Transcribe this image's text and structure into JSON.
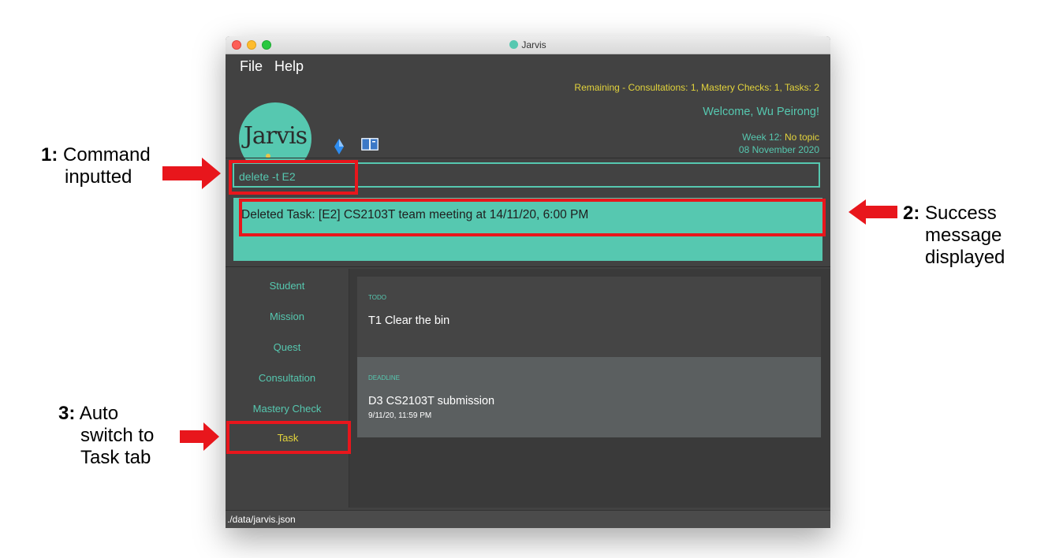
{
  "window": {
    "title": "Jarvis"
  },
  "menu": {
    "file": "File",
    "help": "Help"
  },
  "logo": {
    "text": "Jarvis"
  },
  "header": {
    "remaining": "Remaining - Consultations: 1, Mastery Checks: 1, Tasks: 2",
    "welcome": "Welcome, Wu Peirong!",
    "week_prefix": "Week 12: ",
    "week_topic": "No topic",
    "date": "08 November 2020"
  },
  "command": {
    "value": "delete -t E2"
  },
  "result": {
    "text": "Deleted Task: [E2] CS2103T team meeting at 14/11/20, 6:00 PM"
  },
  "sidebar": {
    "items": [
      {
        "label": "Student"
      },
      {
        "label": "Mission"
      },
      {
        "label": "Quest"
      },
      {
        "label": "Consultation"
      },
      {
        "label": "Mastery Check"
      },
      {
        "label": "Task"
      }
    ]
  },
  "tasks": [
    {
      "type": "TODO",
      "title": "T1 Clear the bin",
      "sub": ""
    },
    {
      "type": "DEADLINE",
      "title": "D3 CS2103T submission",
      "sub": "9/11/20, 11:59 PM"
    }
  ],
  "status": {
    "path": "./data/jarvis.json"
  },
  "annotations": {
    "a1": {
      "num": "1:",
      "line1": "Command",
      "line2": "inputted"
    },
    "a2": {
      "num": "2:",
      "line1": "Success",
      "line2": "message",
      "line3": "displayed"
    },
    "a3": {
      "num": "3:",
      "line1": "Auto",
      "line2": "switch to",
      "line3": "Task tab"
    }
  },
  "colors": {
    "accent": "#56c8b0",
    "highlight": "#e2d33c",
    "annotation_red": "#e8161c",
    "background": "#424242"
  }
}
